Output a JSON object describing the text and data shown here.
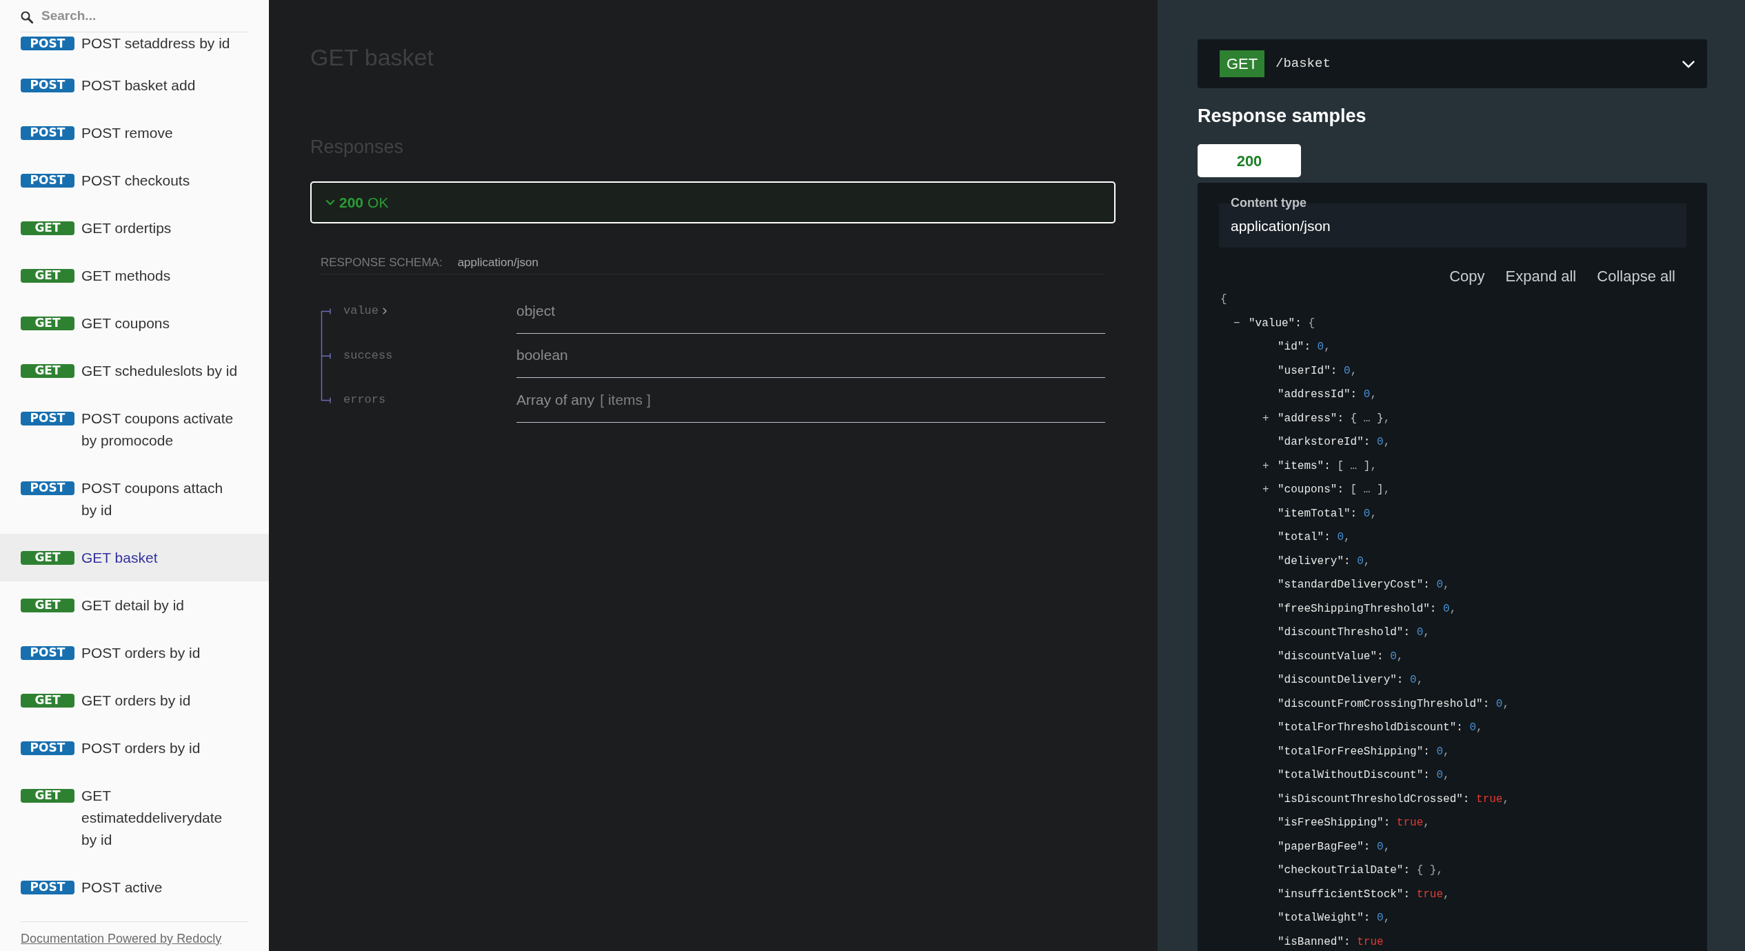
{
  "sidebar": {
    "search": {
      "placeholder": "Search..."
    },
    "items": [
      {
        "badge": {
          "text": "POST",
          "color": "#186faf"
        },
        "label": "POST setaddress by id",
        "selected": false
      },
      {
        "badge": {
          "text": "POST",
          "color": "#186faf"
        },
        "label": "POST basket add",
        "selected": false
      },
      {
        "badge": {
          "text": "POST",
          "color": "#186faf"
        },
        "label": "POST remove",
        "selected": false
      },
      {
        "badge": {
          "text": "POST",
          "color": "#186faf"
        },
        "label": "POST checkouts",
        "selected": false
      },
      {
        "badge": {
          "text": "GET",
          "color": "#2f8132"
        },
        "label": "GET ordertips",
        "selected": false
      },
      {
        "badge": {
          "text": "GET",
          "color": "#2f8132"
        },
        "label": "GET methods",
        "selected": false
      },
      {
        "badge": {
          "text": "GET",
          "color": "#2f8132"
        },
        "label": "GET coupons",
        "selected": false
      },
      {
        "badge": {
          "text": "GET",
          "color": "#2f8132"
        },
        "label": "GET scheduleslots by id",
        "selected": false
      },
      {
        "badge": {
          "text": "POST",
          "color": "#186faf"
        },
        "label": "POST coupons activate by promocode",
        "selected": false
      },
      {
        "badge": {
          "text": "POST",
          "color": "#186faf"
        },
        "label": "POST coupons attach by id",
        "selected": false
      },
      {
        "badge": {
          "text": "GET",
          "color": "#2f8132"
        },
        "label": "GET basket",
        "selected": true
      },
      {
        "badge": {
          "text": "GET",
          "color": "#2f8132"
        },
        "label": "GET detail by id",
        "selected": false
      },
      {
        "badge": {
          "text": "POST",
          "color": "#186faf"
        },
        "label": "POST orders by id",
        "selected": false
      },
      {
        "badge": {
          "text": "GET",
          "color": "#2f8132"
        },
        "label": "GET orders by id",
        "selected": false
      },
      {
        "badge": {
          "text": "POST",
          "color": "#186faf"
        },
        "label": "POST orders by id",
        "selected": false
      },
      {
        "badge": {
          "text": "GET",
          "color": "#2f8132"
        },
        "label": "GET estimateddeliverydate by id",
        "selected": false
      },
      {
        "badge": {
          "text": "POST",
          "color": "#186faf"
        },
        "label": "POST active",
        "selected": false
      }
    ],
    "footer_link": "Documentation Powered by Redocly"
  },
  "operation": {
    "title": "GET basket",
    "responses_heading": "Responses",
    "responses": [
      {
        "code": "200",
        "text": "OK",
        "expanded": true
      }
    ],
    "schema": {
      "label": "RESPONSE SCHEMA:",
      "content_type": "application/json",
      "properties": [
        {
          "name": "value",
          "expandable": true,
          "type": "object"
        },
        {
          "name": "success",
          "expandable": false,
          "type": "boolean"
        },
        {
          "name": "errors",
          "expandable": false,
          "type": "Array of any",
          "items": "[ items ]"
        }
      ]
    }
  },
  "samples": {
    "endpoint": {
      "method": "GET",
      "path": "/basket"
    },
    "heading": "Response samples",
    "tabs": [
      {
        "label": "200",
        "selected": true
      }
    ],
    "content_type": {
      "label": "Content type",
      "value": "application/json"
    },
    "actions": [
      "Copy",
      "Expand all",
      "Collapse all"
    ],
    "code": [
      {
        "kind": "punct",
        "value": "{",
        "children": [
          {
            "toggle": "−",
            "key": "\"value\":",
            "kind": "punct",
            "value": "{",
            "children": [
              {
                "key": "\"id\":",
                "kind": "number",
                "value": "0",
                "suffix": ","
              },
              {
                "key": "\"userId\":",
                "kind": "number",
                "value": "0",
                "suffix": ","
              },
              {
                "key": "\"addressId\":",
                "kind": "number",
                "value": "0",
                "suffix": ","
              },
              {
                "toggle": "+",
                "key": "\"address\":",
                "kind": "collapsed",
                "value": "{ … }",
                "suffix": ","
              },
              {
                "key": "\"darkstoreId\":",
                "kind": "number",
                "value": "0",
                "suffix": ","
              },
              {
                "toggle": "+",
                "key": "\"items\":",
                "kind": "collapsed",
                "value": "[ … ]",
                "suffix": ","
              },
              {
                "toggle": "+",
                "key": "\"coupons\":",
                "kind": "collapsed",
                "value": "[ … ]",
                "suffix": ","
              },
              {
                "key": "\"itemTotal\":",
                "kind": "number",
                "value": "0",
                "suffix": ","
              },
              {
                "key": "\"total\":",
                "kind": "number",
                "value": "0",
                "suffix": ","
              },
              {
                "key": "\"delivery\":",
                "kind": "number",
                "value": "0",
                "suffix": ","
              },
              {
                "key": "\"standardDeliveryCost\":",
                "kind": "number",
                "value": "0",
                "suffix": ","
              },
              {
                "key": "\"freeShippingThreshold\":",
                "kind": "number",
                "value": "0",
                "suffix": ","
              },
              {
                "key": "\"discountThreshold\":",
                "kind": "number",
                "value": "0",
                "suffix": ","
              },
              {
                "key": "\"discountValue\":",
                "kind": "number",
                "value": "0",
                "suffix": ","
              },
              {
                "key": "\"discountDelivery\":",
                "kind": "number",
                "value": "0",
                "suffix": ","
              },
              {
                "key": "\"discountFromCrossingThreshold\":",
                "kind": "number",
                "value": "0",
                "suffix": ","
              },
              {
                "key": "\"totalForThresholdDiscount\":",
                "kind": "number",
                "value": "0",
                "suffix": ","
              },
              {
                "key": "\"totalForFreeShipping\":",
                "kind": "number",
                "value": "0",
                "suffix": ","
              },
              {
                "key": "\"totalWithoutDiscount\":",
                "kind": "number",
                "value": "0",
                "suffix": ","
              },
              {
                "key": "\"isDiscountThresholdCrossed\":",
                "kind": "boolean",
                "value": "true",
                "suffix": ","
              },
              {
                "key": "\"isFreeShipping\":",
                "kind": "boolean",
                "value": "true",
                "suffix": ","
              },
              {
                "key": "\"paperBagFee\":",
                "kind": "number",
                "value": "0",
                "suffix": ","
              },
              {
                "key": "\"checkoutTrialDate\":",
                "kind": "punct",
                "value": "{ }",
                "suffix": ","
              },
              {
                "key": "\"insufficientStock\":",
                "kind": "boolean",
                "value": "true",
                "suffix": ","
              },
              {
                "key": "\"totalWeight\":",
                "kind": "number",
                "value": "0",
                "suffix": ","
              },
              {
                "key": "\"isBanned\":",
                "kind": "boolean",
                "value": "true"
              }
            ]
          }
        ]
      }
    ]
  }
}
